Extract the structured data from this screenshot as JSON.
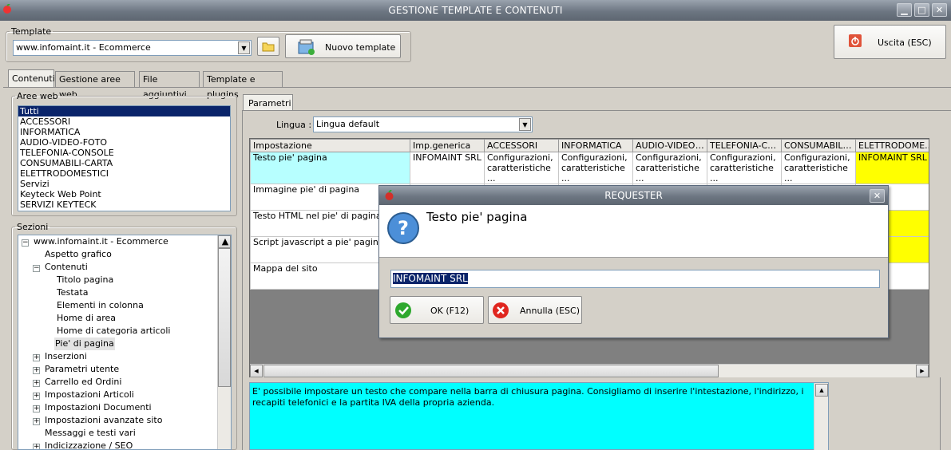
{
  "window": {
    "title": "GESTIONE TEMPLATE E CONTENUTI",
    "minimize": "▁",
    "maximize": "□",
    "close": "✕"
  },
  "template": {
    "legend": "Template",
    "selected": "www.infomaint.it - Ecommerce",
    "new_label": "Nuovo template"
  },
  "exit_label": "Uscita (ESC)",
  "tabs": [
    "Contenuti",
    "Gestione aree web",
    "File aggiuntivi",
    "Template e plugins"
  ],
  "aree": {
    "legend": "Aree web",
    "items": [
      "Tutti",
      "ACCESSORI",
      "INFORMATICA",
      "AUDIO-VIDEO-FOTO",
      "TELEFONIA-CONSOLE",
      "CONSUMABILI-CARTA",
      "ELETTRODOMESTICI",
      "Servizi",
      "Keyteck Web Point",
      "SERVIZI KEYTECK"
    ]
  },
  "sezioni": {
    "legend": "Sezioni",
    "items": [
      {
        "label": "www.infomaint.it - Ecommerce",
        "exp": "−"
      },
      {
        "label": "Aspetto grafico",
        "exp": ""
      },
      {
        "label": "Contenuti",
        "exp": "−"
      },
      {
        "label": "Titolo pagina",
        "exp": ""
      },
      {
        "label": "Testata",
        "exp": ""
      },
      {
        "label": "Elementi in colonna",
        "exp": ""
      },
      {
        "label": "Home di area",
        "exp": ""
      },
      {
        "label": "Home di categoria articoli",
        "exp": ""
      },
      {
        "label": "Pie' di pagina",
        "exp": ""
      },
      {
        "label": "Inserzioni",
        "exp": "+"
      },
      {
        "label": "Parametri utente",
        "exp": "+"
      },
      {
        "label": "Carrello ed Ordini",
        "exp": "+"
      },
      {
        "label": "Impostazioni Articoli",
        "exp": "+"
      },
      {
        "label": "Impostazioni Documenti",
        "exp": "+"
      },
      {
        "label": "Impostazioni avanzate sito",
        "exp": "+"
      },
      {
        "label": "Messaggi e testi vari",
        "exp": ""
      },
      {
        "label": "Indicizzazione / SEO",
        "exp": "+"
      }
    ]
  },
  "parametri": {
    "tab": "Parametri",
    "lingua_label": "Lingua :",
    "lingua_value": "Lingua default"
  },
  "grid": {
    "headers": [
      "Impostazione",
      "Imp.generica",
      "ACCESSORI",
      "INFORMATICA",
      "AUDIO-VIDEO-...",
      "TELEFONIA-CO...",
      "CONSUMABILI-...",
      "ELETTRODOME..."
    ],
    "rows": [
      [
        "Testo pie' pagina",
        "INFOMAINT SRL",
        "Configurazioni, caratteristiche ...",
        "Configurazioni, caratteristiche ...",
        "Configurazioni, caratteristiche ...",
        "Configurazioni, caratteristiche ...",
        "Configurazioni, caratteristiche ...",
        "INFOMAINT SRL"
      ],
      [
        "Immagine pie' di pagina",
        "",
        "",
        "",
        "",
        "",
        "",
        ""
      ],
      [
        "Testo HTML nel pie' di pagina",
        "",
        "",
        "",
        "",
        "",
        "",
        ""
      ],
      [
        "Script javascript a pie' pagina",
        "",
        "",
        "",
        "",
        "",
        "",
        ""
      ],
      [
        "Mappa del sito",
        "",
        "",
        "",
        "",
        "",
        "",
        ""
      ]
    ]
  },
  "description": "E' possibile impostare un testo che compare nella barra di chiusura pagina. Consigliamo di inserire l'intestazione, l'indirizzo, i recapiti telefonici e la partita IVA della propria azienda.",
  "dialog": {
    "title": "REQUESTER",
    "close": "✕",
    "question": "Testo pie' pagina",
    "value": "INFOMAINT SRL",
    "ok": "OK (F12)",
    "cancel": "Annulla (ESC)"
  },
  "colors": {
    "cyan": "#b7ffff",
    "yellow": "#ffff00",
    "desc": "#00ffff",
    "selection": "#0a246a"
  }
}
